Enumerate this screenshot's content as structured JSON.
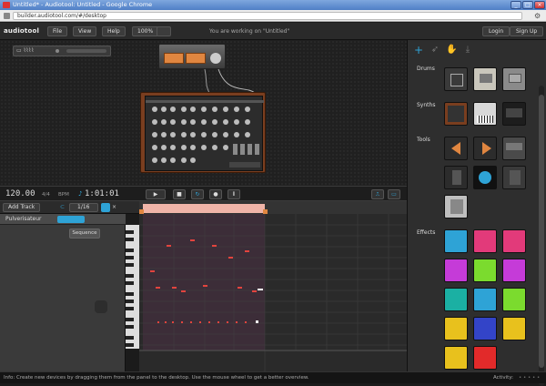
{
  "browser": {
    "window_title": "Untitled* - Audiotool: Untitled - Google Chrome",
    "url": "builder.audiotool.com/#/desktop"
  },
  "appbar": {
    "logo": "audiotool",
    "menu": [
      "File",
      "View",
      "Help"
    ],
    "zoom": "100%",
    "status": "You are working on \"Untitled\"",
    "login": "Login",
    "signup": "Sign Up"
  },
  "transport": {
    "bpm": "120.00",
    "signature": "4/4",
    "bpm_unit": "BPM",
    "position": "1:01:01"
  },
  "tracks": {
    "add_track": "Add Track",
    "quantize": "1/16",
    "track_name": "Pulverisateur",
    "clip_label": "Sequence"
  },
  "panel": {
    "categories": [
      "Drums",
      "Synths",
      "Tools",
      "Effects"
    ]
  },
  "statusbar": {
    "info": "Info: Create new devices by dragging them from the panel to the desktop. Use the mouse wheel to get a better overview.",
    "activity": "Activity:"
  },
  "colors": {
    "accent": "#2ea3d6",
    "note": "#e2443e",
    "clip": "#f0b4a8",
    "device_wood": "#7a3e1f"
  },
  "icons": [
    "plus-icon",
    "cursor-icon",
    "hand-icon",
    "download-icon",
    "play-icon",
    "stop-icon",
    "loop-icon",
    "record-icon",
    "folder-icon",
    "piano-icon"
  ]
}
